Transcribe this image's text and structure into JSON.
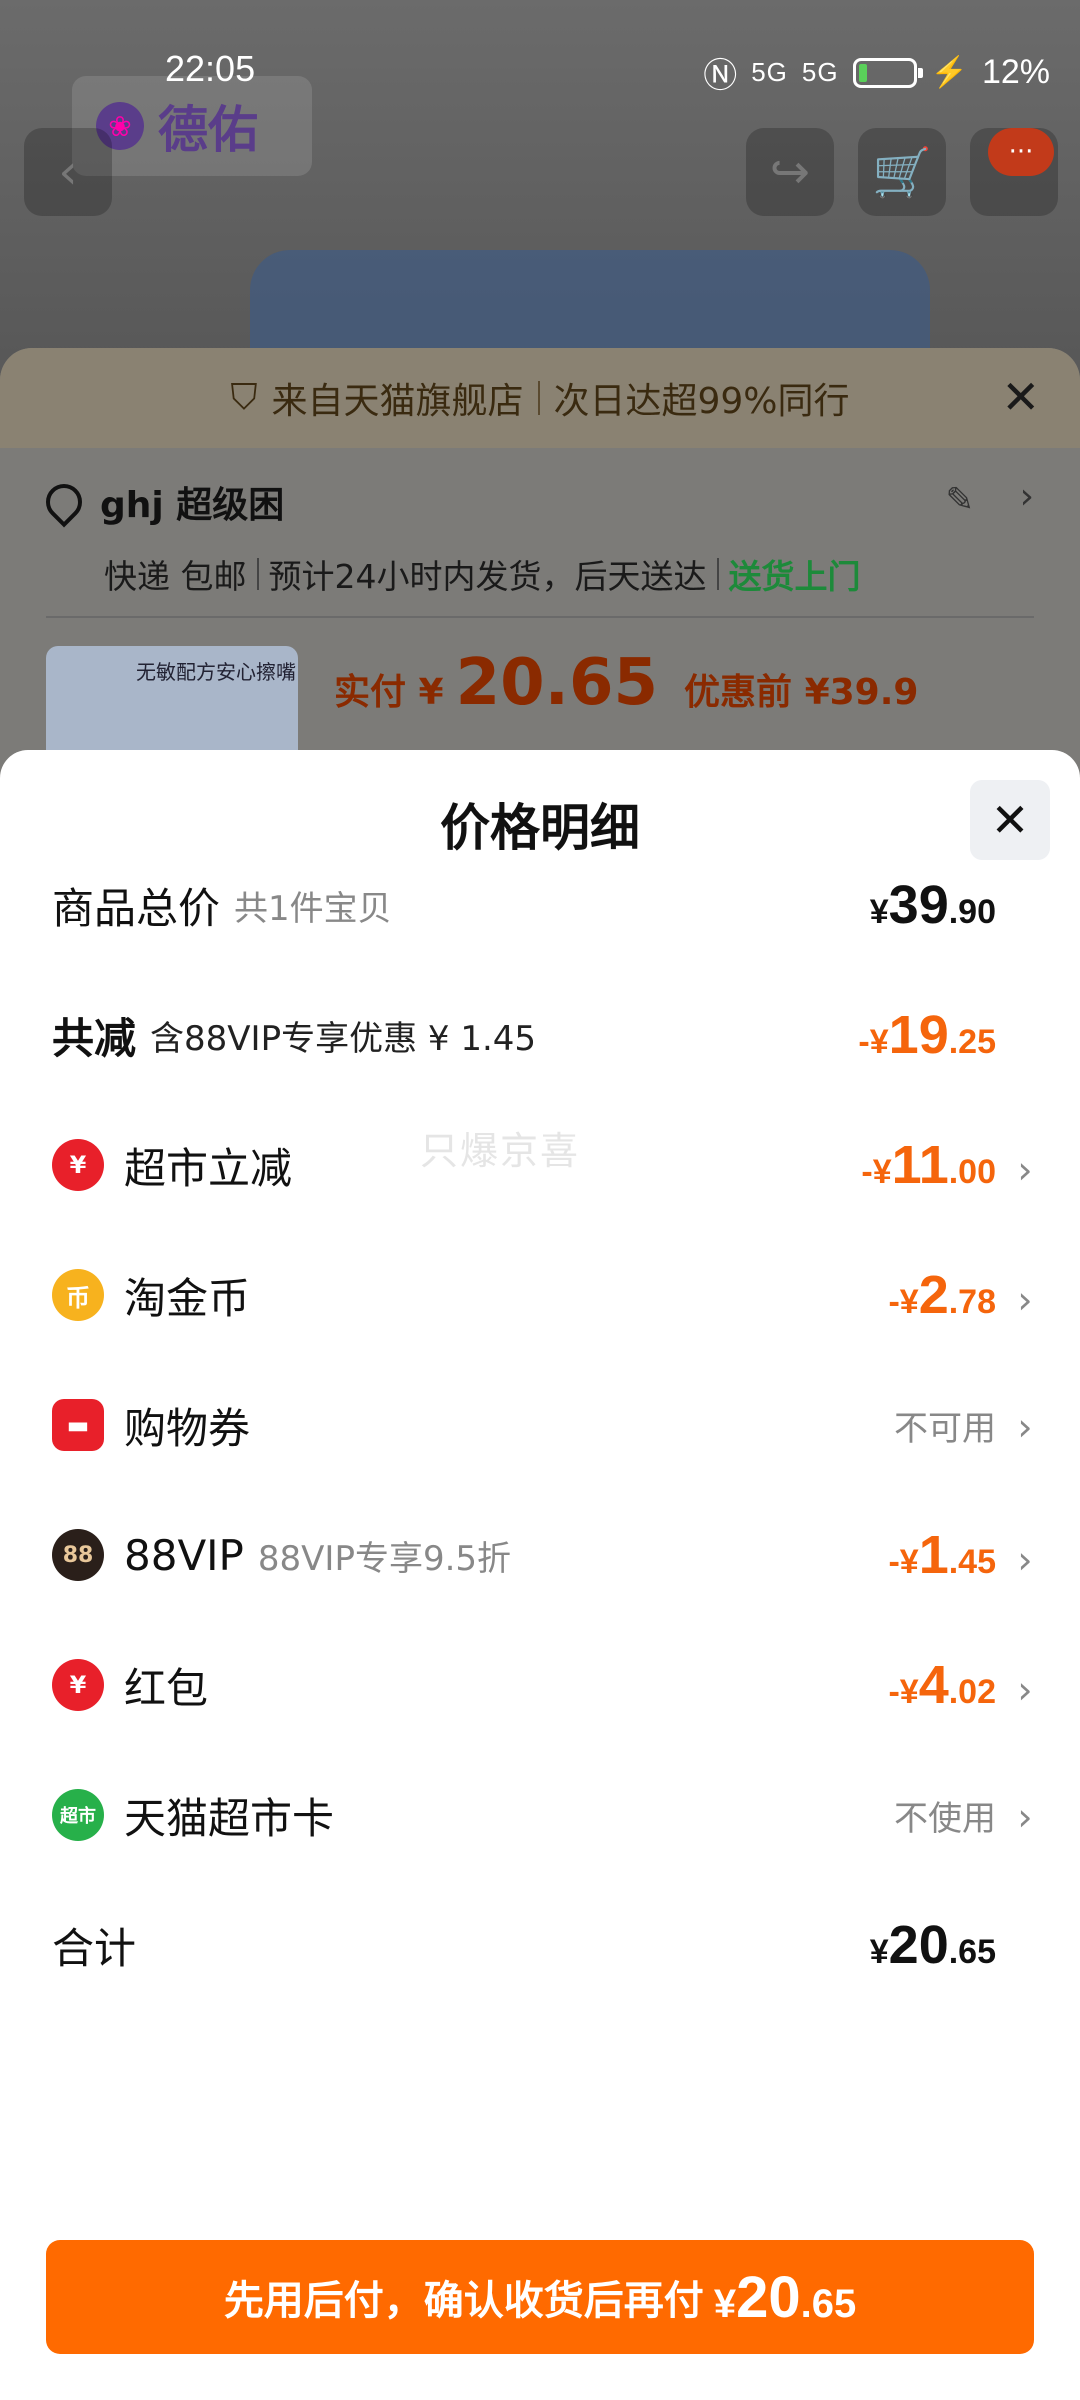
{
  "status_bar": {
    "time": "22:05",
    "network1": "5G",
    "network2": "5G",
    "battery": "12%"
  },
  "background": {
    "brand": "德佑",
    "banner": {
      "part1": "来自天猫旗舰店",
      "part2": "次日达超99%同行"
    },
    "address": {
      "name": "ghj 超级困",
      "shipping": "快递 包邮",
      "eta": "预计24小时内发货，后天送达",
      "door": "送货上门"
    },
    "product_thumb_text": "无敏配方安心擦嘴",
    "pay": {
      "label": "实付 ¥",
      "amount": "20.65",
      "before": "优惠前 ¥39.9"
    }
  },
  "sheet": {
    "title": "价格明细",
    "watermark": "只爆京喜",
    "rows": [
      {
        "label": "商品总价",
        "sub": "共1件宝贝",
        "price": {
          "sym": "¥",
          "int": "39",
          "dec": ".90"
        }
      },
      {
        "label": "共减",
        "sub": "含88VIP专享优惠 ¥ 1.45",
        "price": {
          "sym": "-¥",
          "int": "19",
          "dec": ".25"
        }
      },
      {
        "label": "超市立减",
        "icon": "yuan-coupon-icon",
        "price": {
          "sym": "-¥",
          "int": "11",
          "dec": ".00"
        }
      },
      {
        "label": "淘金币",
        "icon": "coin-icon",
        "icon_text": "币",
        "price": {
          "sym": "-¥",
          "int": "2",
          "dec": ".78"
        }
      },
      {
        "label": "购物券",
        "icon": "ticket-icon",
        "status": "不可用"
      },
      {
        "label": "88VIP",
        "icon": "88vip-icon",
        "icon_text": "88",
        "sub": "88VIP专享9.5折",
        "price": {
          "sym": "-¥",
          "int": "1",
          "dec": ".45"
        }
      },
      {
        "label": "红包",
        "icon": "red-packet-icon",
        "icon_text": "¥",
        "price": {
          "sym": "-¥",
          "int": "4",
          "dec": ".02"
        }
      },
      {
        "label": "天猫超市卡",
        "icon": "supermarket-card-icon",
        "icon_text": "超市",
        "status": "不使用"
      },
      {
        "label": "合计",
        "price": {
          "sym": "¥",
          "int": "20",
          "dec": ".65"
        }
      }
    ],
    "cta": {
      "text": "先用后付，确认收货后再付",
      "sym": "¥",
      "int": "20",
      "dec": ".65"
    }
  },
  "colors": {
    "accent": "#ff6a00",
    "discount": "#f5650c",
    "discount_green": "#1d8a3a"
  }
}
